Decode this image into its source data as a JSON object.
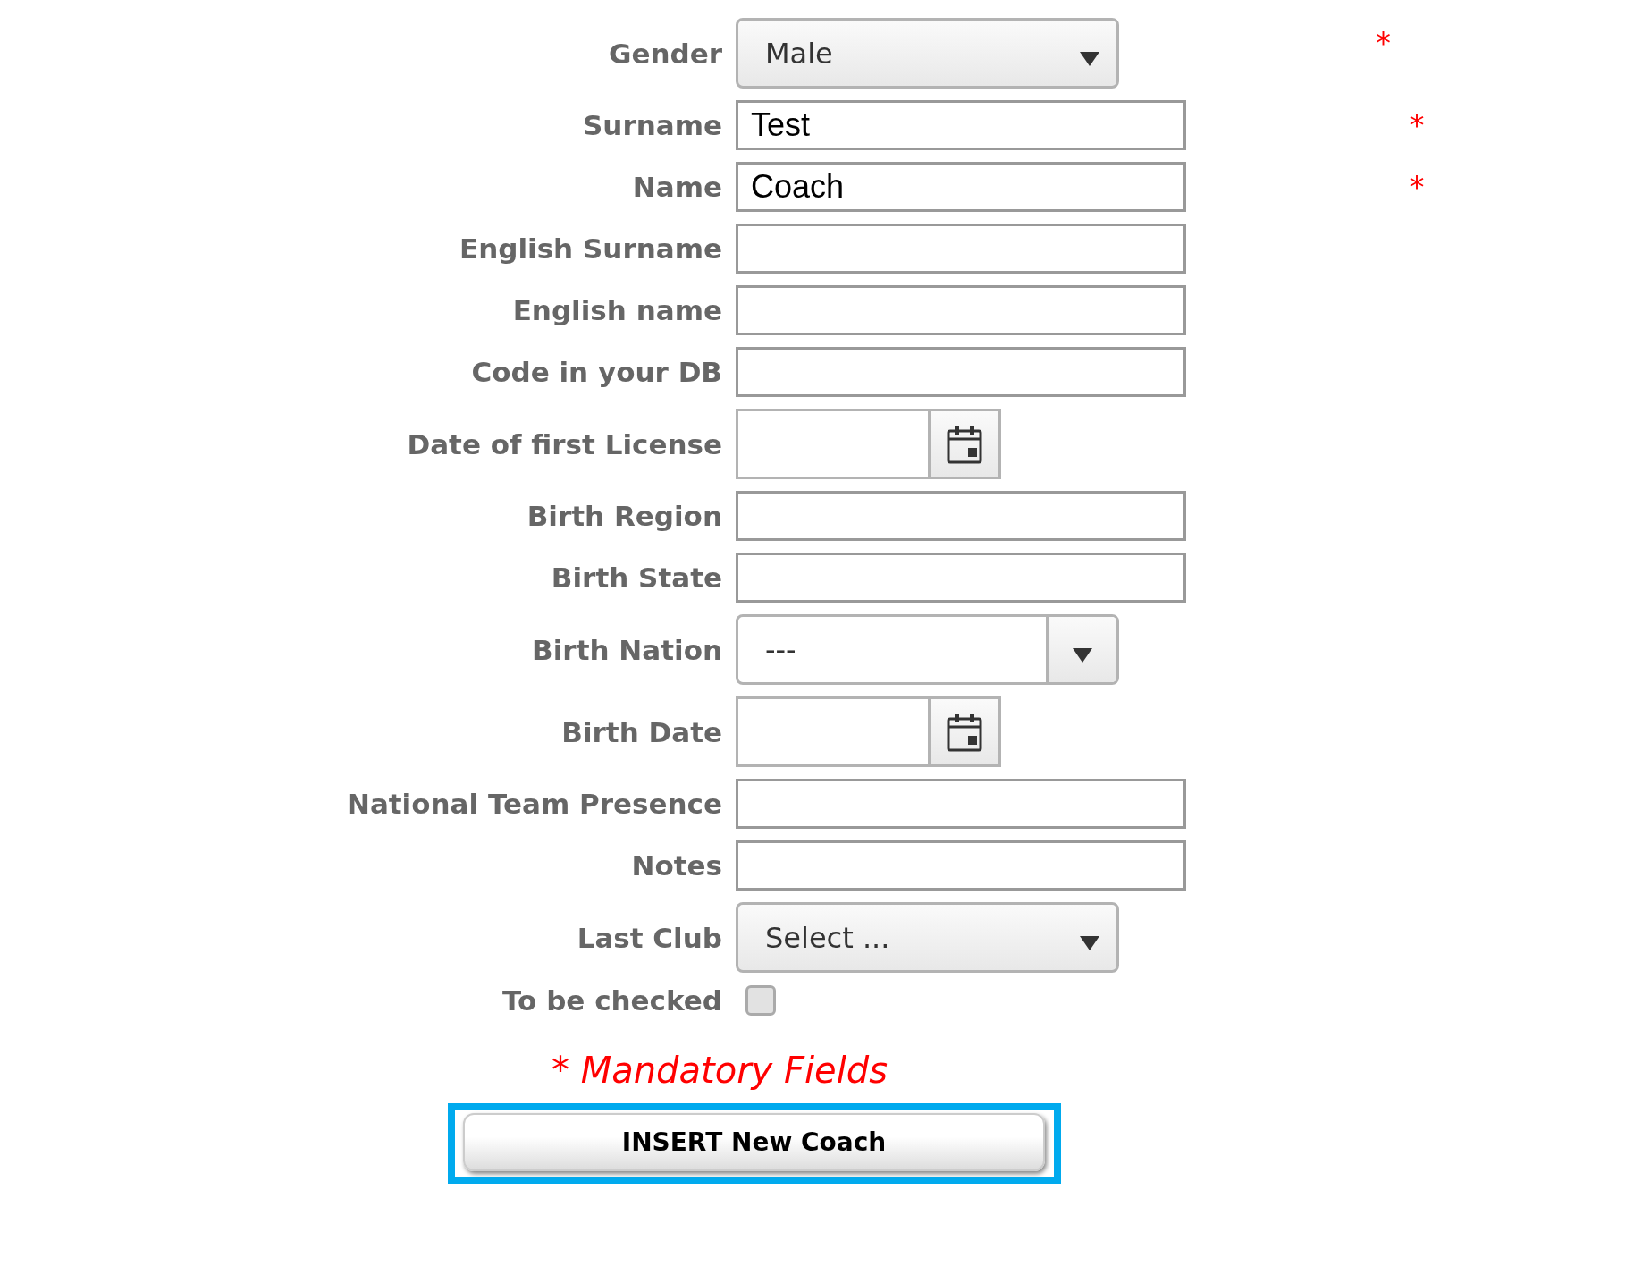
{
  "fields": [
    {
      "label": "Gender",
      "kind": "select",
      "value": "Male",
      "required_mark": "*"
    },
    {
      "label": "Surname",
      "kind": "text",
      "value": "Test",
      "required_mark": "*"
    },
    {
      "label": "Name",
      "kind": "text",
      "value": "Coach",
      "required_mark": "*"
    },
    {
      "label": "English Surname",
      "kind": "text"
    },
    {
      "label": "English name",
      "kind": "text"
    },
    {
      "label": "Code in your DB",
      "kind": "text"
    },
    {
      "label": "Date of first License",
      "kind": "date"
    },
    {
      "label": "Birth Region",
      "kind": "text"
    },
    {
      "label": "Birth State",
      "kind": "text"
    },
    {
      "label": "Birth Nation",
      "kind": "combo",
      "value": "---"
    },
    {
      "label": "Birth Date",
      "kind": "date"
    },
    {
      "label": "National Team Presence",
      "kind": "text"
    },
    {
      "label": "Notes",
      "kind": "text"
    },
    {
      "label": "Last Club",
      "kind": "select",
      "value": "Select ..."
    },
    {
      "label": "To be checked",
      "kind": "checkbox",
      "checked": false
    }
  ],
  "mandatory_note": "* *Mandatory Fields*",
  "submit_button": "INSERT New Coach"
}
